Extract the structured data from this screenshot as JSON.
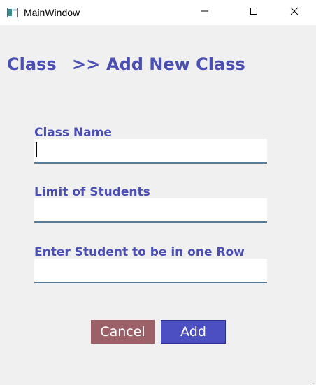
{
  "window": {
    "title": "MainWindow",
    "icon": "app-window-icon",
    "controls": [
      "minimize-icon",
      "maximize-icon",
      "close-icon"
    ]
  },
  "breadcrumb": {
    "root": "Class",
    "separator": ">>",
    "current": "Add New Class"
  },
  "form": {
    "class_name": {
      "label": "Class Name",
      "value": ""
    },
    "limit_students": {
      "label": "Limit of Students",
      "value": ""
    },
    "students_per_row": {
      "label": "Enter Student to be in one Row",
      "value": ""
    }
  },
  "actions": {
    "cancel_label": "Cancel",
    "add_label": "Add"
  },
  "colors": {
    "accent": "#4b4eb2",
    "cancel": "#9c6068",
    "add": "#4b4fc2",
    "background": "#f0f0f0"
  }
}
